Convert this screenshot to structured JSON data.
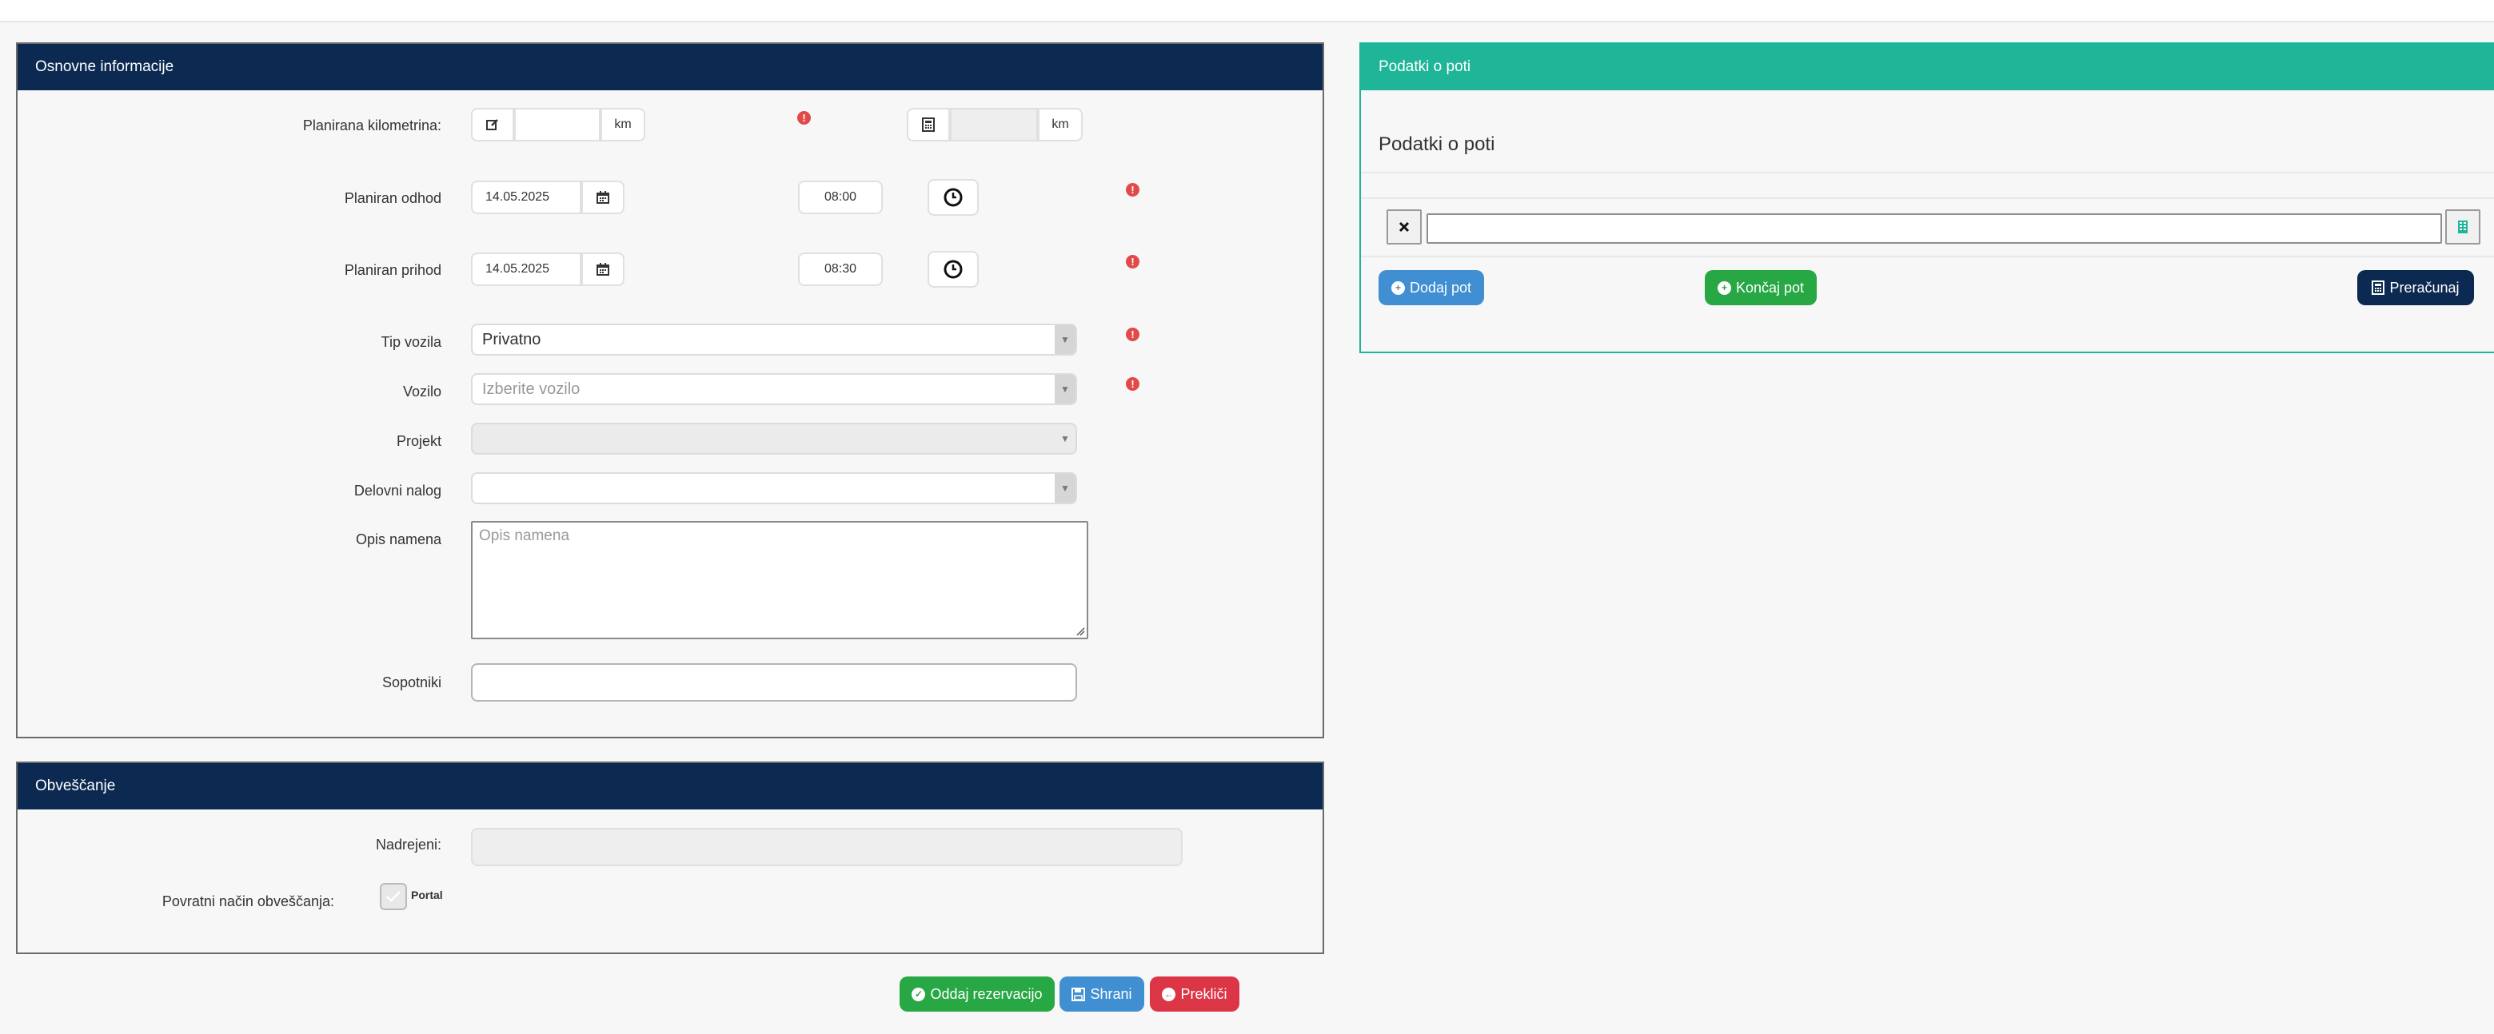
{
  "basic": {
    "title": "Osnovne informacije",
    "planned_km_label": "Planirana kilometrina:",
    "planned_km_value": "",
    "calc_km_value": "",
    "km_unit": "km",
    "departure_label": "Planiran odhod",
    "departure_date": "14.05.2025",
    "departure_time": "08:00",
    "arrival_label": "Planiran prihod",
    "arrival_date": "14.05.2025",
    "arrival_time": "08:30",
    "vehicle_type_label": "Tip vozila",
    "vehicle_type_value": "Privatno",
    "vehicle_label": "Vozilo",
    "vehicle_placeholder": "Izberite vozilo",
    "project_label": "Projekt",
    "project_value": "",
    "work_order_label": "Delovni nalog",
    "work_order_value": "",
    "purpose_label": "Opis namena",
    "purpose_placeholder": "Opis namena",
    "passengers_label": "Sopotniki",
    "passengers_value": ""
  },
  "notify": {
    "title": "Obveščanje",
    "supervisor_label": "Nadrejeni:",
    "supervisor_value": "",
    "method_label": "Povratni način obveščanja:",
    "portal_label": "Portal",
    "portal_checked": true
  },
  "route": {
    "title": "Podatki o poti",
    "heading": "Podatki o poti",
    "stop_value": "",
    "add_label": "Dodaj pot",
    "finish_label": "Končaj pot",
    "recalc_label": "Preračunaj"
  },
  "actions": {
    "submit_label": "Oddaj rezervacijo",
    "save_label": "Shrani",
    "cancel_label": "Prekliči"
  },
  "colors": {
    "header_navy": "#0c2a51",
    "header_teal": "#1fb598",
    "error_red": "#e24a4a",
    "success_green": "#28a745",
    "primary_blue": "#3f8fd2",
    "danger_red": "#dc3545"
  },
  "icons": {
    "edit": "edit-icon",
    "calculator": "calculator-icon",
    "calendar": "calendar-icon",
    "clock": "clock-icon",
    "error": "exclamation-circle-icon",
    "remove": "close-icon",
    "check": "check-circle-icon",
    "save": "floppy-disk-icon",
    "cancel": "arrow-circle-left-icon",
    "add": "plus-circle-icon"
  }
}
